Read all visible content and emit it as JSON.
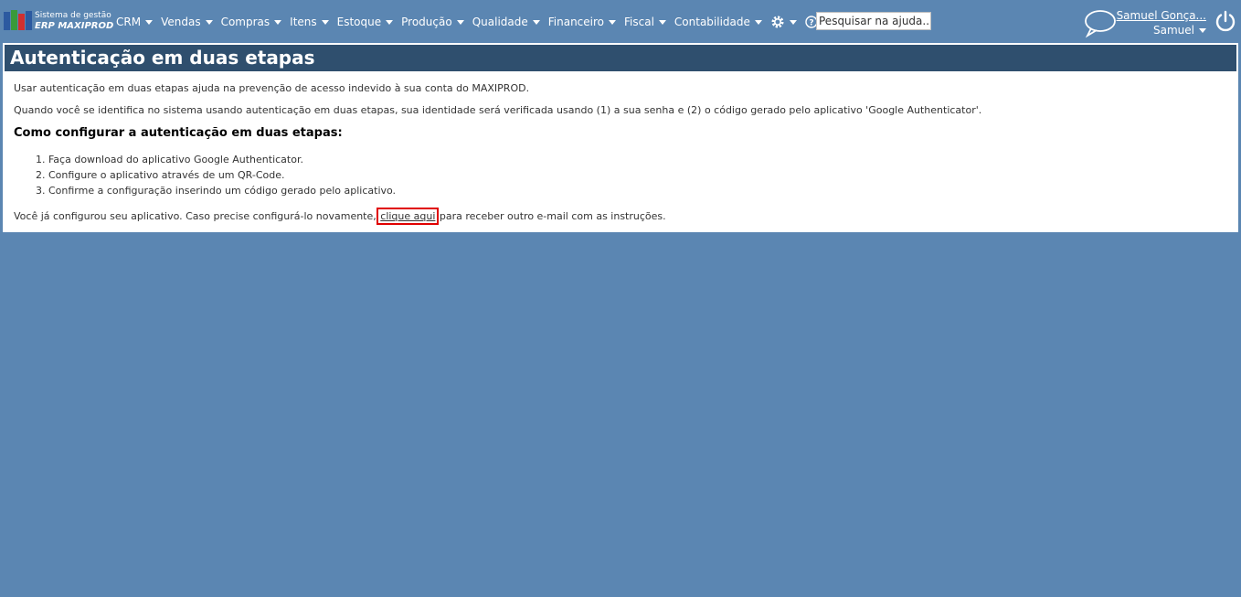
{
  "brand": {
    "subtitle": "Sistema de gestão",
    "name": "ERP MAXIPROD"
  },
  "menu": [
    {
      "label": "CRM"
    },
    {
      "label": "Vendas"
    },
    {
      "label": "Compras"
    },
    {
      "label": "Itens"
    },
    {
      "label": "Estoque"
    },
    {
      "label": "Produção"
    },
    {
      "label": "Qualidade"
    },
    {
      "label": "Financeiro"
    },
    {
      "label": "Fiscal"
    },
    {
      "label": "Contabilidade"
    }
  ],
  "icons": {
    "settings": "gear-icon",
    "help": "help-icon",
    "chat": "chat-bubble-icon",
    "power": "power-icon"
  },
  "search": {
    "placeholder": "Pesquisar na ajuda..."
  },
  "user": {
    "full_name": "Samuel Gonça...",
    "short_name": "Samuel"
  },
  "page": {
    "title": "Autenticação em duas etapas",
    "intro1": "Usar autenticação em duas etapas ajuda na prevenção de acesso indevido à sua conta do MAXIPROD.",
    "intro2": "Quando você se identifica no sistema usando autenticação em duas etapas, sua identidade será verificada usando (1) a sua senha e (2) o código gerado pelo aplicativo 'Google Authenticator'.",
    "subtitle": "Como configurar a autenticação em duas etapas:",
    "steps": [
      "1. Faça download do aplicativo Google Authenticator.",
      "2. Configure o aplicativo através de um QR-Code.",
      "3. Confirme a configuração inserindo um código gerado pelo aplicativo."
    ],
    "final_before": "Você já configurou seu aplicativo. Caso precise configurá-lo novamente, ",
    "final_link": "clique aqui",
    "final_after": " para receber outro e-mail com as instruções."
  },
  "colors": {
    "background": "#5b86b2",
    "header": "#2f4f6e",
    "highlight": "#e00000"
  }
}
